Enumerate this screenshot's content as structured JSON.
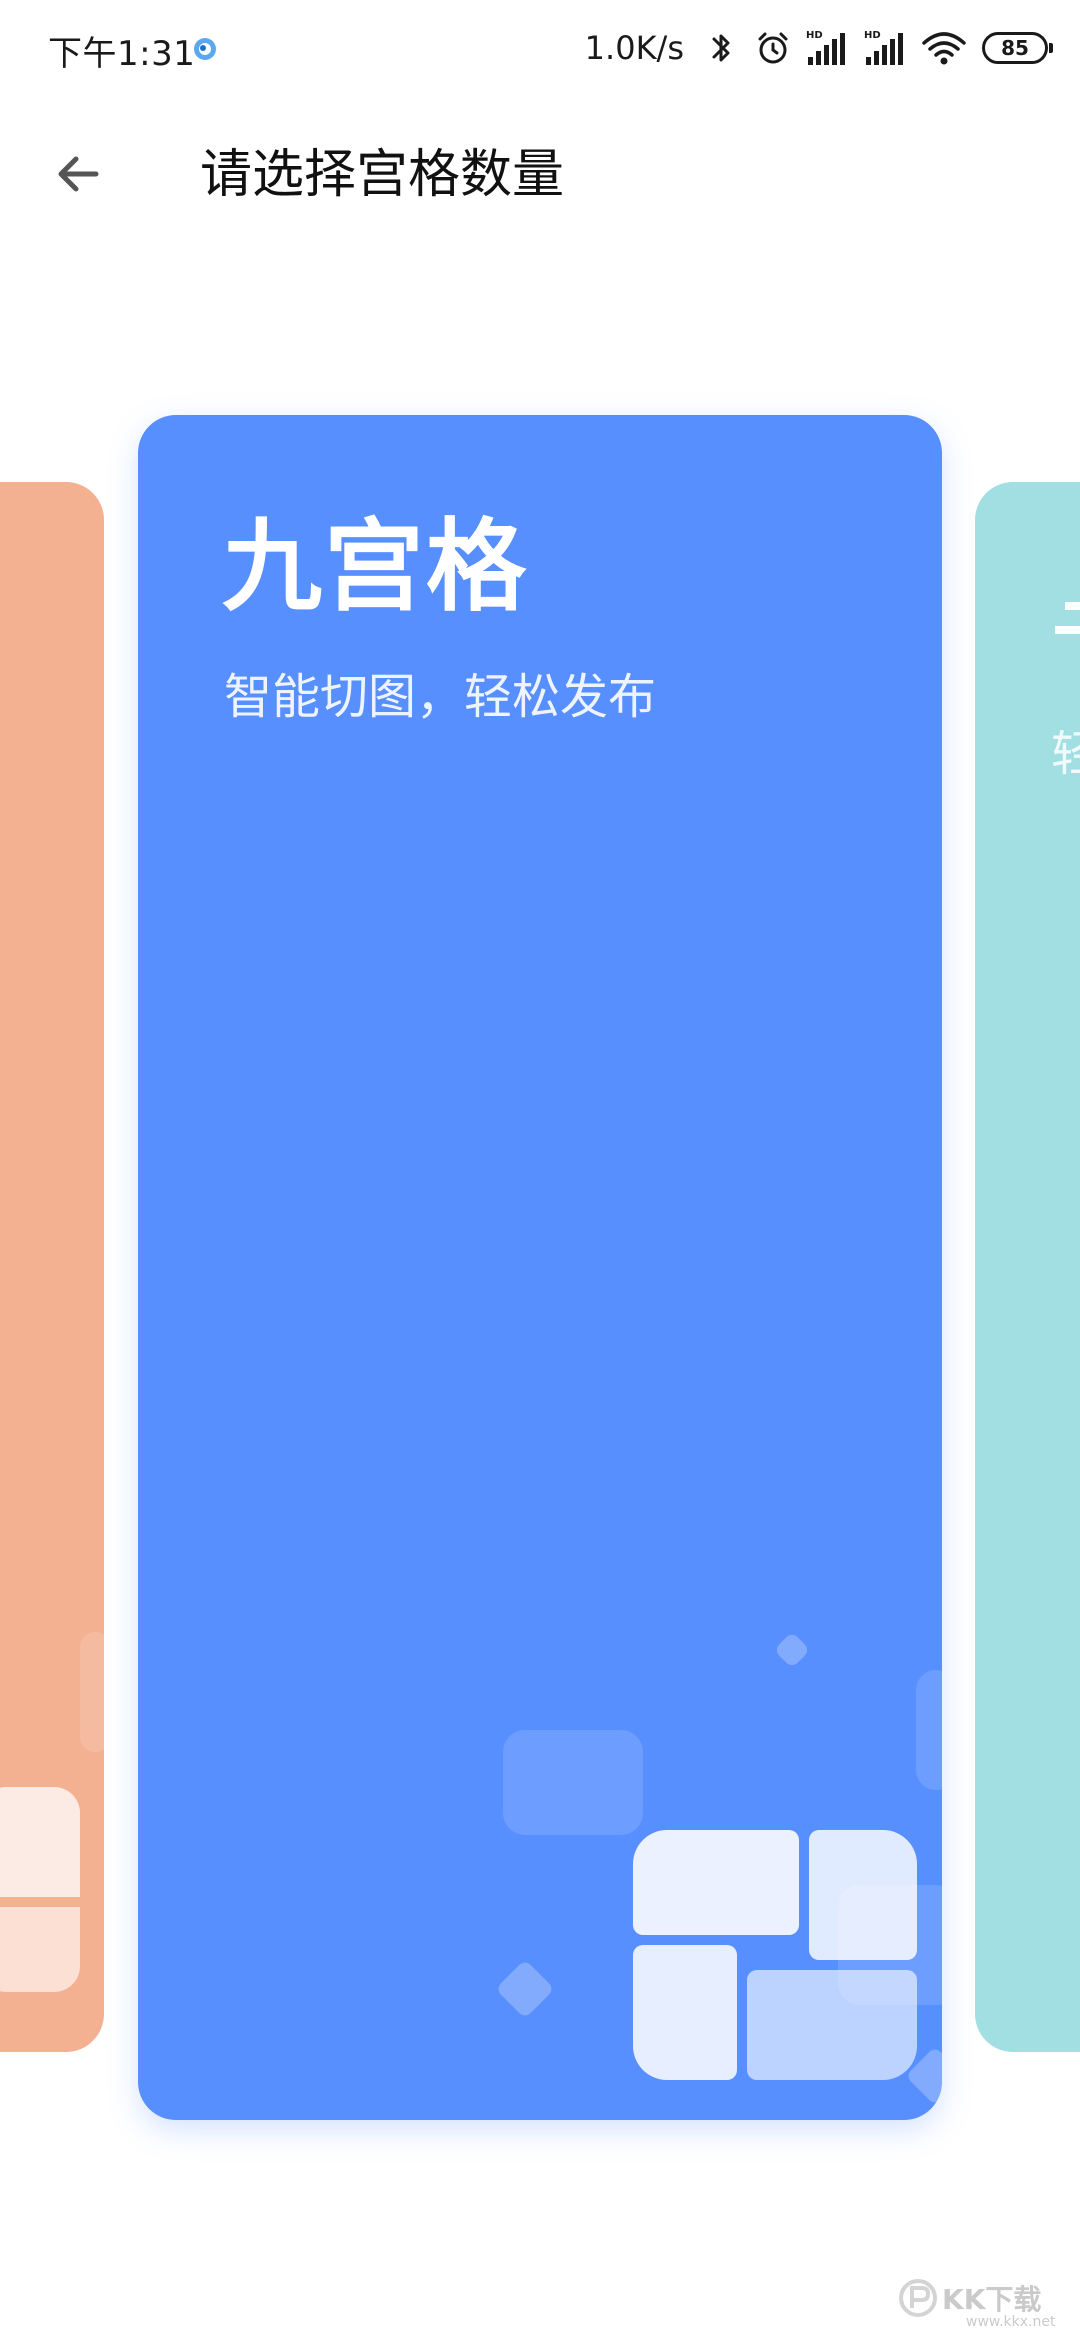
{
  "status_bar": {
    "time": "下午1:31",
    "network_speed": "1.0K/s",
    "battery_level": "85",
    "icons": [
      "app-notification-icon",
      "bluetooth-icon",
      "alarm-icon",
      "hd-signal-icon",
      "hd-signal-icon",
      "wifi-icon",
      "battery-icon"
    ]
  },
  "app_bar": {
    "title": "请选择宫格数量",
    "back_icon": "arrow-left-icon"
  },
  "cards": {
    "left": {
      "color": "#f4b192"
    },
    "main": {
      "title": "九宫格",
      "subtitle": "智能切图，轻松发布",
      "color": "#588ffe"
    },
    "right": {
      "title_peek": "",
      "subtitle_peek": "轻",
      "color": "#a1dfe3"
    }
  },
  "watermark": {
    "text": "KK下载",
    "url": "www.kkx.net"
  }
}
